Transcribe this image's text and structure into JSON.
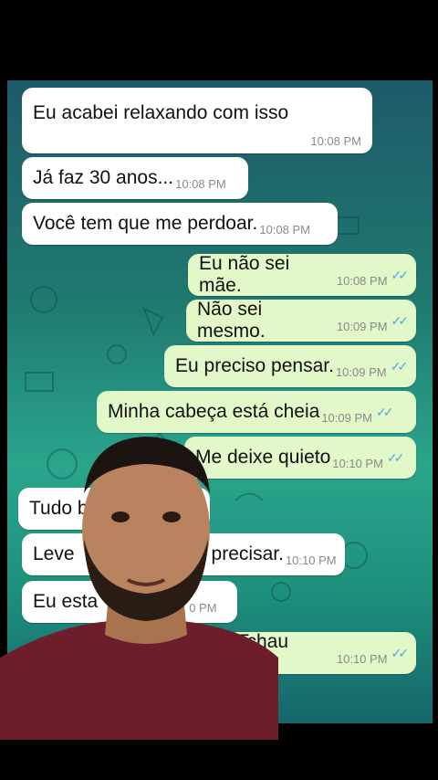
{
  "messages": [
    {
      "text": "Eu acabei relaxando com isso",
      "time": "10:08 PM",
      "dir": "in"
    },
    {
      "text": "Já faz 30 anos...",
      "time": "10:08 PM",
      "dir": "in"
    },
    {
      "text": "Você tem que me perdoar.",
      "time": "10:08 PM",
      "dir": "in"
    },
    {
      "text": "Eu não sei mãe.",
      "time": "10:08 PM",
      "dir": "out"
    },
    {
      "text": "Não sei mesmo.",
      "time": "10:09 PM",
      "dir": "out"
    },
    {
      "text": "Eu preciso pensar.",
      "time": "10:09 PM",
      "dir": "out"
    },
    {
      "text": "Minha cabeça está cheia",
      "time": "10:09 PM",
      "dir": "out"
    },
    {
      "text": "Me deixe quieto",
      "time": "10:10 PM",
      "dir": "out"
    },
    {
      "text": "Tudo b",
      "time": "",
      "dir": "in"
    },
    {
      "text": "Leve",
      "text2": "precisar.",
      "time": "10:10 PM",
      "dir": "in"
    },
    {
      "text": "Eu esta",
      "time": "0 PM",
      "dir": "in"
    },
    {
      "text": "Tchau mãe.",
      "time": "10:10 PM",
      "dir": "out"
    }
  ],
  "read_ticks": "✓✓",
  "colors": {
    "incoming": "#ffffff",
    "outgoing": "#e2f8c8",
    "tick": "#4fa8e8",
    "wallpaper": "#1f7a70"
  }
}
